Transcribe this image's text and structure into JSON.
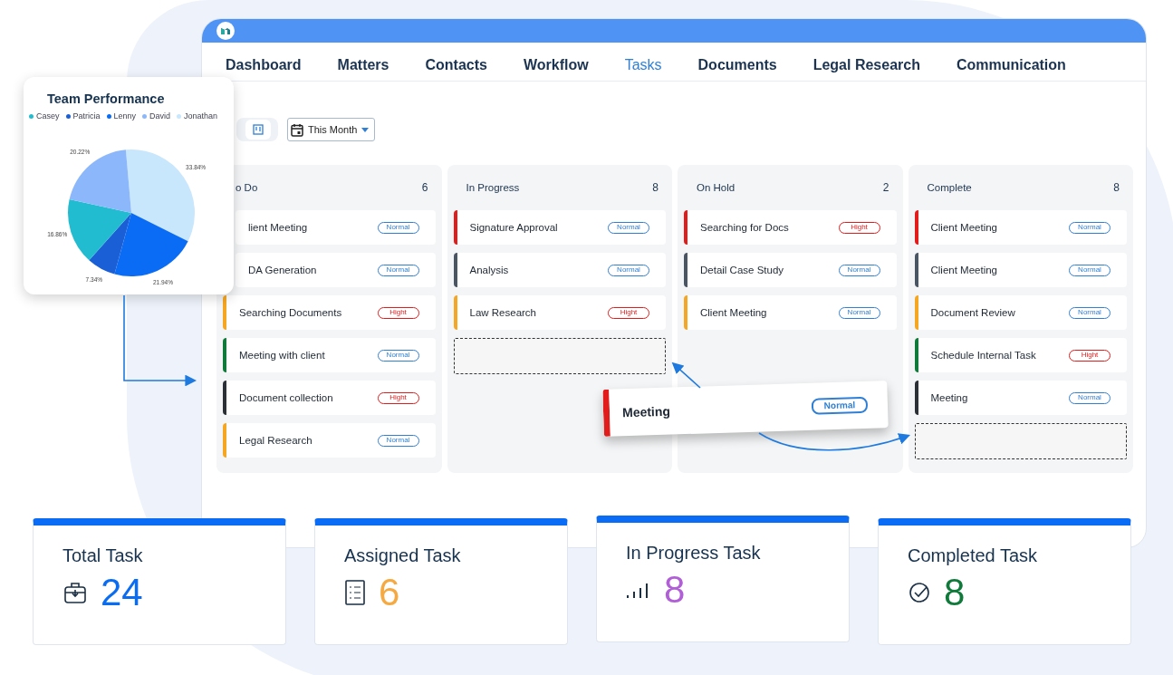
{
  "nav": {
    "tabs": [
      {
        "label": "Dashboard",
        "selected": false
      },
      {
        "label": "Matters",
        "selected": false
      },
      {
        "label": "Contacts",
        "selected": false
      },
      {
        "label": "Workflow",
        "selected": false
      },
      {
        "label": "Tasks",
        "selected": true
      },
      {
        "label": "Documents",
        "selected": false
      },
      {
        "label": "Legal Research",
        "selected": false
      },
      {
        "label": "Communication",
        "selected": false
      }
    ]
  },
  "toolbar": {
    "board_view": {
      "selected": true
    },
    "date_filter": "This Month"
  },
  "board": {
    "columns": [
      {
        "title": "o Do",
        "count": "6",
        "drop_zone": false,
        "cards": [
          {
            "title": "lient Meeting",
            "badge": "Normal",
            "kind": "normal"
          },
          {
            "title": "DA Generation",
            "badge": "Normal",
            "kind": "normal"
          },
          {
            "title": "Searching Documents",
            "badge": "Hight",
            "kind": "high",
            "color": "#f5a623"
          },
          {
            "title": "Meeting with client",
            "badge": "Normal",
            "kind": "normal",
            "color": "#0f7a3a"
          },
          {
            "title": "Document collection",
            "badge": "Hight",
            "kind": "high",
            "color": "#2b2f36"
          },
          {
            "title": "Legal Research",
            "badge": "Normal",
            "kind": "normal",
            "color": "#f5a623"
          }
        ]
      },
      {
        "title": "In Progress",
        "count": "8",
        "drop_zone": true,
        "cards": [
          {
            "title": "Signature Approval",
            "badge": "Normal",
            "kind": "normal",
            "color": "#e21b1b"
          },
          {
            "title": "Analysis",
            "badge": "Normal",
            "kind": "normal",
            "color": "#4a5563"
          },
          {
            "title": "Law Research",
            "badge": "Hight",
            "kind": "high",
            "color": "#f5a623"
          }
        ]
      },
      {
        "title": "On Hold",
        "count": "2",
        "drop_zone": false,
        "cards": [
          {
            "title": "Searching for Docs",
            "badge": "Hight",
            "kind": "high",
            "color": "#e21b1b"
          },
          {
            "title": "Detail Case Study",
            "badge": "Normal",
            "kind": "normal",
            "color": "#4a5563"
          },
          {
            "title": "Client Meeting",
            "badge": "Normal",
            "kind": "normal",
            "color": "#f5a623"
          }
        ]
      },
      {
        "title": "Complete",
        "count": "8",
        "drop_zone": true,
        "cards": [
          {
            "title": "Client Meeting",
            "badge": "Normal",
            "kind": "normal",
            "color": "#e21b1b"
          },
          {
            "title": "Client Meeting",
            "badge": "Normal",
            "kind": "normal",
            "color": "#4a5563"
          },
          {
            "title": "Document Review",
            "badge": "Normal",
            "kind": "normal",
            "color": "#f5a623"
          },
          {
            "title": "Schedule Internal Task",
            "badge": "Hight",
            "kind": "high",
            "color": "#0f7a3a"
          },
          {
            "title": "Meeting",
            "badge": "Normal",
            "kind": "normal",
            "color": "#2b2f36"
          }
        ]
      }
    ]
  },
  "dragged_card": {
    "title": "Meeting",
    "badge": "Normal",
    "kind": "normal",
    "color": "#e21b1b"
  },
  "team_performance": {
    "chart_data": {
      "type": "pie",
      "title": "Team Performance",
      "categories": [
        "Casey",
        "Patricia",
        "Lenny",
        "David",
        "Jonathan"
      ],
      "values": [
        16.86,
        7.34,
        21.94,
        20.22,
        33.84
      ],
      "colors": [
        "#22bcd0",
        "#1a5fd6",
        "#0a6cf5",
        "#8cb8fb",
        "#c8e6fc"
      ],
      "value_labels": [
        "16.86%",
        "7.34%",
        "21.94%",
        "20.22%",
        "33.84%"
      ]
    }
  },
  "stats": [
    {
      "title": "Total Task",
      "value": "24",
      "color": "#0a6cf0"
    },
    {
      "title": "Assigned Task",
      "value": "6",
      "color": "#f5a940"
    },
    {
      "title": "In Progress Task",
      "value": "8",
      "color": "#b05fd6"
    },
    {
      "title": "Completed Task",
      "value": "8",
      "color": "#0f7a3a"
    }
  ]
}
